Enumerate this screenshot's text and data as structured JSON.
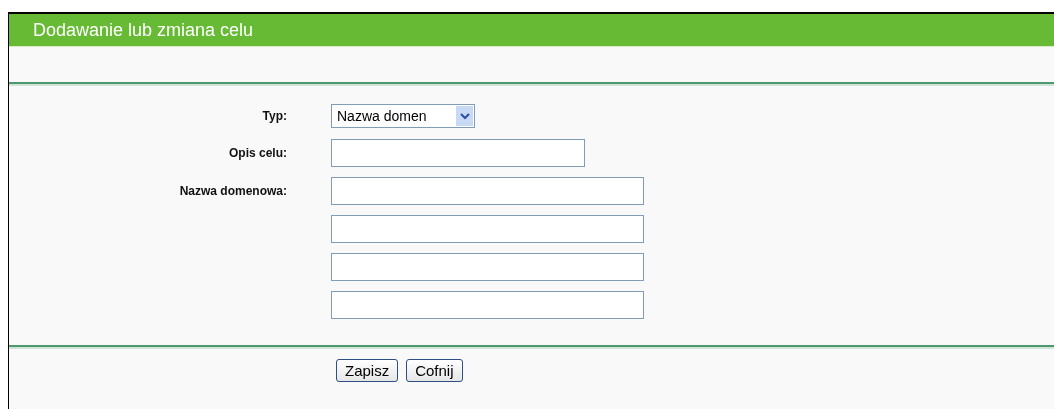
{
  "title": "Dodawanie lub zmiana celu",
  "form": {
    "type": {
      "label": "Typ:",
      "value": "Nazwa domen"
    },
    "description": {
      "label": "Opis celu:",
      "kind": "text"
    },
    "domains": {
      "label": "Nazwa domenowa:",
      "fields": [
        {
          "kind": "text"
        },
        {
          "kind": "text"
        },
        {
          "kind": "text"
        },
        {
          "kind": "text"
        }
      ]
    }
  },
  "buttons": [
    "Zapisz",
    "Cofnij"
  ]
}
